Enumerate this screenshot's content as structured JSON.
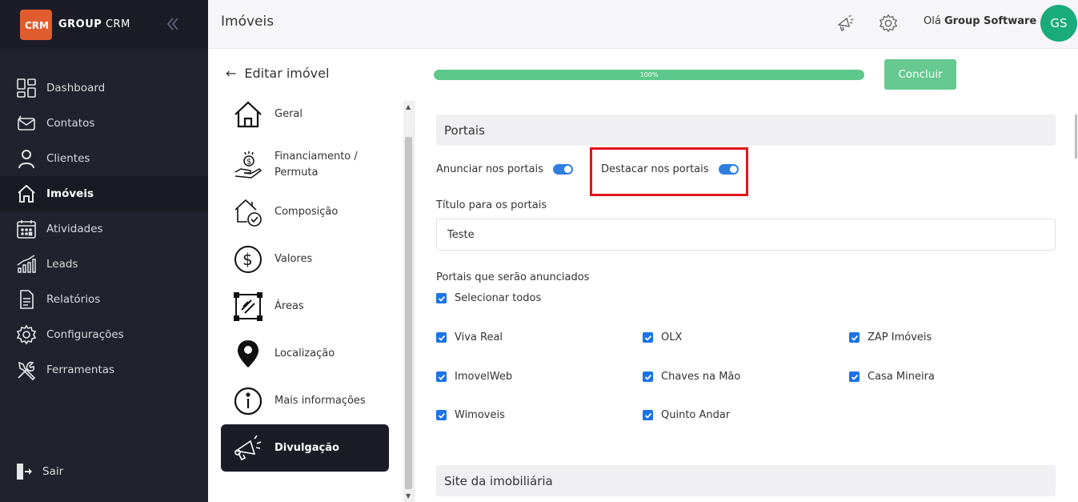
{
  "brand": {
    "logo_text": "CRM",
    "name_bold": "GROUP",
    "name_rest": "CRM"
  },
  "sidebar": {
    "items": [
      {
        "label": "Dashboard",
        "icon": "dashboard-icon"
      },
      {
        "label": "Contatos",
        "icon": "contacts-icon"
      },
      {
        "label": "Clientes",
        "icon": "user-icon"
      },
      {
        "label": "Imóveis",
        "icon": "home-icon",
        "active": true
      },
      {
        "label": "Atividades",
        "icon": "calendar-icon"
      },
      {
        "label": "Leads",
        "icon": "chart-icon"
      },
      {
        "label": "Relatórios",
        "icon": "document-icon"
      },
      {
        "label": "Configurações",
        "icon": "gear-icon"
      },
      {
        "label": "Ferramentas",
        "icon": "tools-icon"
      }
    ],
    "logout": "Sair"
  },
  "header": {
    "title": "Imóveis",
    "greeting_prefix": "Olá",
    "user_name": "Group Software",
    "avatar_initials": "GS"
  },
  "editor": {
    "back_label": "Editar imóvel",
    "progress": 100,
    "progress_label": "100%",
    "finish_button": "Concluir"
  },
  "sections": [
    {
      "label": "Geral",
      "icon": "house-icon"
    },
    {
      "label": "Financiamento / Permuta",
      "icon": "money-hand-icon"
    },
    {
      "label": "Composição",
      "icon": "house-check-icon"
    },
    {
      "label": "Valores",
      "icon": "dollar-circle-icon"
    },
    {
      "label": "Áreas",
      "icon": "area-icon"
    },
    {
      "label": "Localização",
      "icon": "location-pin-icon"
    },
    {
      "label": "Mais informações",
      "icon": "info-icon"
    },
    {
      "label": "Divulgação",
      "icon": "megaphone-icon",
      "active": true
    }
  ],
  "portais": {
    "heading": "Portais",
    "announce_toggle_label": "Anunciar nos portais",
    "highlight_toggle_label": "Destacar nos portais",
    "title_label": "Título para os portais",
    "title_value": "Teste",
    "portals_label": "Portais que serão anunciados",
    "select_all": "Selecionar todos",
    "portals": [
      "Viva Real",
      "OLX",
      "ZAP Imóveis",
      "ImovelWeb",
      "Chaves na Mão",
      "Casa Mineira",
      "Wimoveis",
      "Quinto Andar"
    ]
  },
  "site": {
    "heading": "Site da imobiliária"
  },
  "colors": {
    "sidebar_bg": "#22222e",
    "accent_green": "#66c98f",
    "toggle_blue": "#2f7fe0",
    "highlight_red": "#e0141b",
    "avatar_bg": "#1aab7a"
  }
}
